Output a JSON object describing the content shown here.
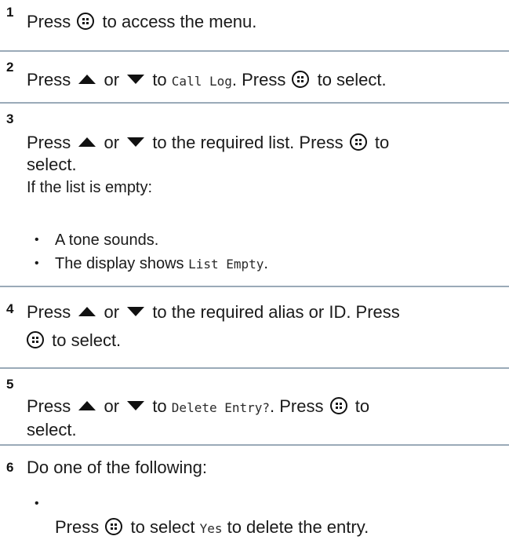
{
  "steps": [
    {
      "number": "1",
      "parts": {
        "a": "Press",
        "b": "to access the menu."
      }
    },
    {
      "number": "2",
      "parts": {
        "a": "Press",
        "or": "or",
        "to": "to",
        "menu": "Call Log",
        "press": ". Press",
        "end": "to select."
      }
    },
    {
      "number": "3",
      "parts": {
        "a": "Press",
        "or": "or",
        "b": "to the required list. Press",
        "c": "to",
        "d": "select.",
        "e": "If the list is empty:"
      },
      "bullets": [
        {
          "text": "A tone sounds."
        },
        {
          "pre": "The display shows",
          "mono": "List Empty",
          "post": "."
        }
      ]
    },
    {
      "number": "4",
      "parts": {
        "a": "Press",
        "or": "or",
        "b": "to the required alias or ID. Press",
        "c": "to select."
      }
    },
    {
      "number": "5",
      "parts": {
        "a": "Press",
        "or": "or",
        "to": "to",
        "menu": "Delete Entry?",
        "press": ". Press",
        "c": "to",
        "d": "select."
      }
    },
    {
      "number": "6",
      "parts": {
        "a": "Do one of the following:"
      },
      "bullets": [
        {
          "pre": "Press",
          "mid": "to select",
          "mono": "Yes",
          "post": "to delete the entry."
        }
      ]
    }
  ],
  "icons": {
    "menu": "menu-ok-button-icon",
    "up": "up-arrow-icon",
    "down": "down-arrow-icon"
  }
}
